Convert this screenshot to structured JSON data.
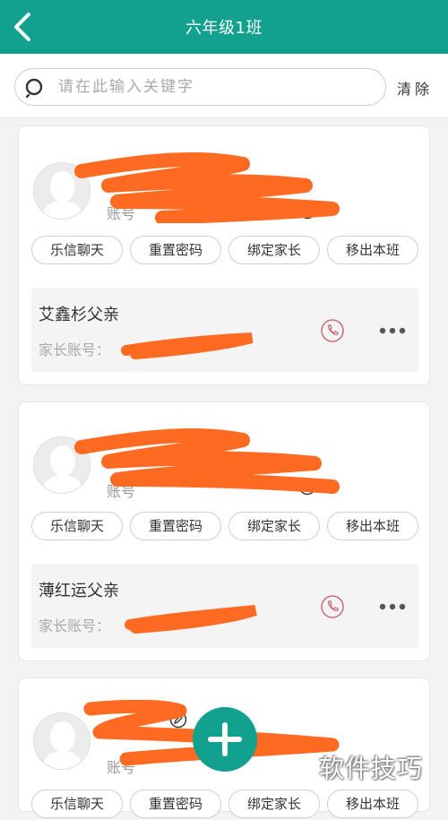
{
  "header": {
    "title": "六年级1班",
    "back_icon": "chevron-left-icon"
  },
  "search": {
    "placeholder": "请在此输入关键字",
    "value": "",
    "clear_label": "清除"
  },
  "colors": {
    "primary": "#12a08f",
    "scribble": "#ff6a22",
    "phone_icon": "#c9717f"
  },
  "students": [
    {
      "account_label": "账号",
      "actions": [
        "乐信聊天",
        "重置密码",
        "绑定家长",
        "移出本班"
      ],
      "parent": {
        "name": "艾鑫杉父亲",
        "account_label": "家长账号："
      }
    },
    {
      "account_label": "账号",
      "actions": [
        "乐信聊天",
        "重置密码",
        "绑定家长",
        "移出本班"
      ],
      "parent": {
        "name": "薄红运父亲",
        "account_label": "家长账号："
      }
    },
    {
      "account_label": "账号",
      "actions": [
        "乐信聊天",
        "重置密码",
        "绑定家长",
        "移出本班"
      ]
    }
  ],
  "fab": {
    "icon": "plus-icon"
  },
  "watermark": {
    "text": "软件技巧"
  }
}
